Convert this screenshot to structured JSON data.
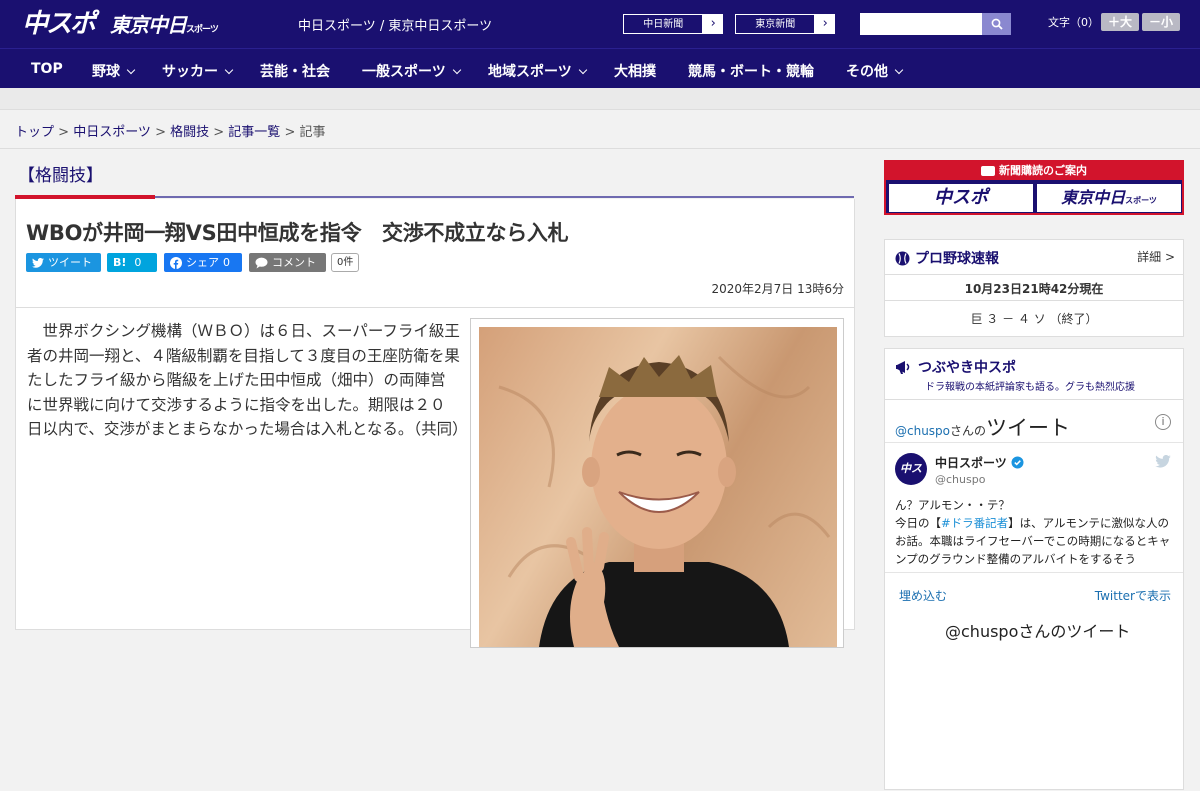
{
  "header": {
    "logo_chuspo": "中スポ",
    "logo_tokyo": "東京中日",
    "logo_tokyo_small": "スポーツ",
    "site_links": "中日スポーツ / 東京中日スポーツ",
    "chunichi_shinbun": "中日新聞",
    "tokyo_shinbun": "東京新聞",
    "arrow": "›",
    "search_placeholder": "",
    "font_label": "文字（0）",
    "font_bigger": "＋大",
    "font_smaller": "－小"
  },
  "nav": {
    "items": [
      {
        "label": "TOP"
      },
      {
        "label": "野球"
      },
      {
        "label": "サッカー"
      },
      {
        "label": "芸能・社会"
      },
      {
        "label": "一般スポーツ"
      },
      {
        "label": "地域スポーツ"
      },
      {
        "label": "大相撲"
      },
      {
        "label": "競馬・ボート・競輪"
      },
      {
        "label": "その他"
      }
    ]
  },
  "breadcrumb": {
    "top": "トップ",
    "chunichi": "中日スポーツ",
    "kakutougi": "格闘技",
    "list": "記事一覧",
    "current": "記事",
    "sep": " > "
  },
  "article": {
    "category": "【格闘技】",
    "headline": "WBOが井岡一翔VS田中恒成を指令　交渉不成立なら入札",
    "tweet_label": "ツイート",
    "hatena_label": "B!",
    "hatena_count": "0",
    "share_label": "シェア",
    "share_count": "0",
    "comment_label": "コメント",
    "comment_count": "0件",
    "date": "2020年2月7日 13時6分",
    "body": "世界ボクシング機構（ＷＢＯ）は６日、スーパーフライ級王者の井岡一翔と、４階級制覇を目指して３度目の王座防衛を果たしたフライ級から階級を上げた田中恒成（畑中）の両陣営に世界戦に向けて交渉するように指令を出した。期限は２０日以内で、交渉がまとまらなかった場合は入札となる。（共同）"
  },
  "sidebar": {
    "sub_head": "新聞購読のご案内",
    "sub_chuspo": "中スポ",
    "sub_tokyo": "東京中日",
    "sub_tokyo_small": "スポーツ",
    "score_title": "プロ野球速報",
    "score_detail": "詳細 >",
    "score_time": "10月23日21時42分現在",
    "score_result": "巨 ３ － ４ ソ （終了）",
    "tw_title": "つぶやき中スポ",
    "tw_sub": "ドラ報戦の本紙評論家も語る。グラも熱烈応援",
    "tw_handle_link": "@chuspo",
    "tw_san": "さんの",
    "tw_tweet": "ツイート",
    "tw_info": "i",
    "tw_avatar": "中スポ",
    "tw_name": "中日スポーツ",
    "tw_handle": "@chuspo",
    "tw_line1": "ん？アルモン・・テ？",
    "tw_line2_pre": "今日の【",
    "tw_line2_tag": "#ドラ番記者",
    "tw_line2_post": "】は、アルモンテに激似な人のお話。本職はライフセーバーでこの時期になるとキャンプのグラウンド整備のアルバイトをするそう",
    "tw_embed": "埋め込む",
    "tw_view": "Twitterで表示",
    "tw_footer": "@chuspoさんのツイート"
  },
  "colors": {
    "brand": "#1a1070",
    "accent_red": "#d2142c",
    "twitter": "#1b95e0",
    "hatena": "#00a4de",
    "facebook": "#1877f2",
    "comment": "#777777"
  }
}
